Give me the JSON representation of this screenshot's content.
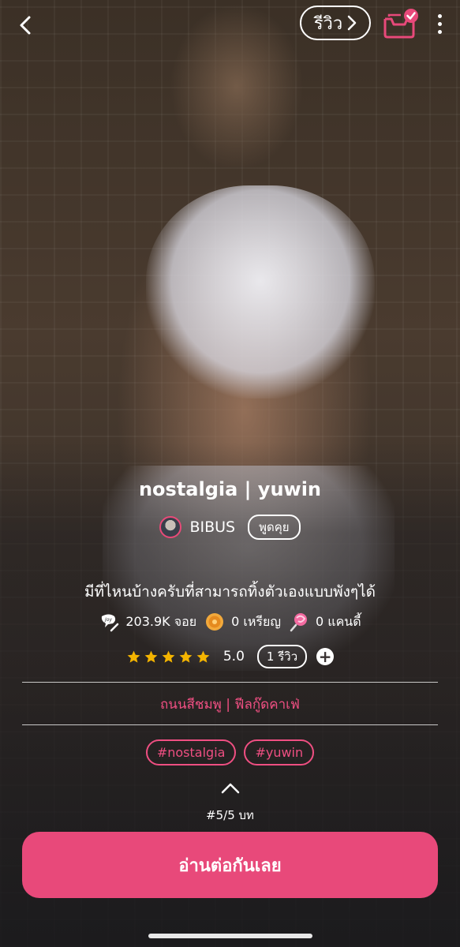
{
  "header": {
    "review_label": "รีวิว"
  },
  "story": {
    "title": "nostalgia | yuwin",
    "author": "BIBUS",
    "chat_label": "พูดคุย",
    "description": "มีที่ไหนบ้างครับที่สามารถทิ้งตัวเองแบบพังๆได้"
  },
  "stats": {
    "views": "203.9K จอย",
    "coins": "0 เหรียญ",
    "candies": "0 แคนดี้"
  },
  "rating": {
    "stars": 5,
    "value": "5.0",
    "review_count": "1 รีวิว"
  },
  "category": "ถนนสีชมพู | ฟีลกู๊ดคาเฟ่",
  "tags": [
    "#nostalgia",
    "#yuwin"
  ],
  "chapter": "#5/5 บท",
  "read_button_label": "อ่านต่อกันเลย",
  "colors": {
    "accent": "#e8497a",
    "star": "#f4b400",
    "background_overlay": "#2b2420"
  }
}
